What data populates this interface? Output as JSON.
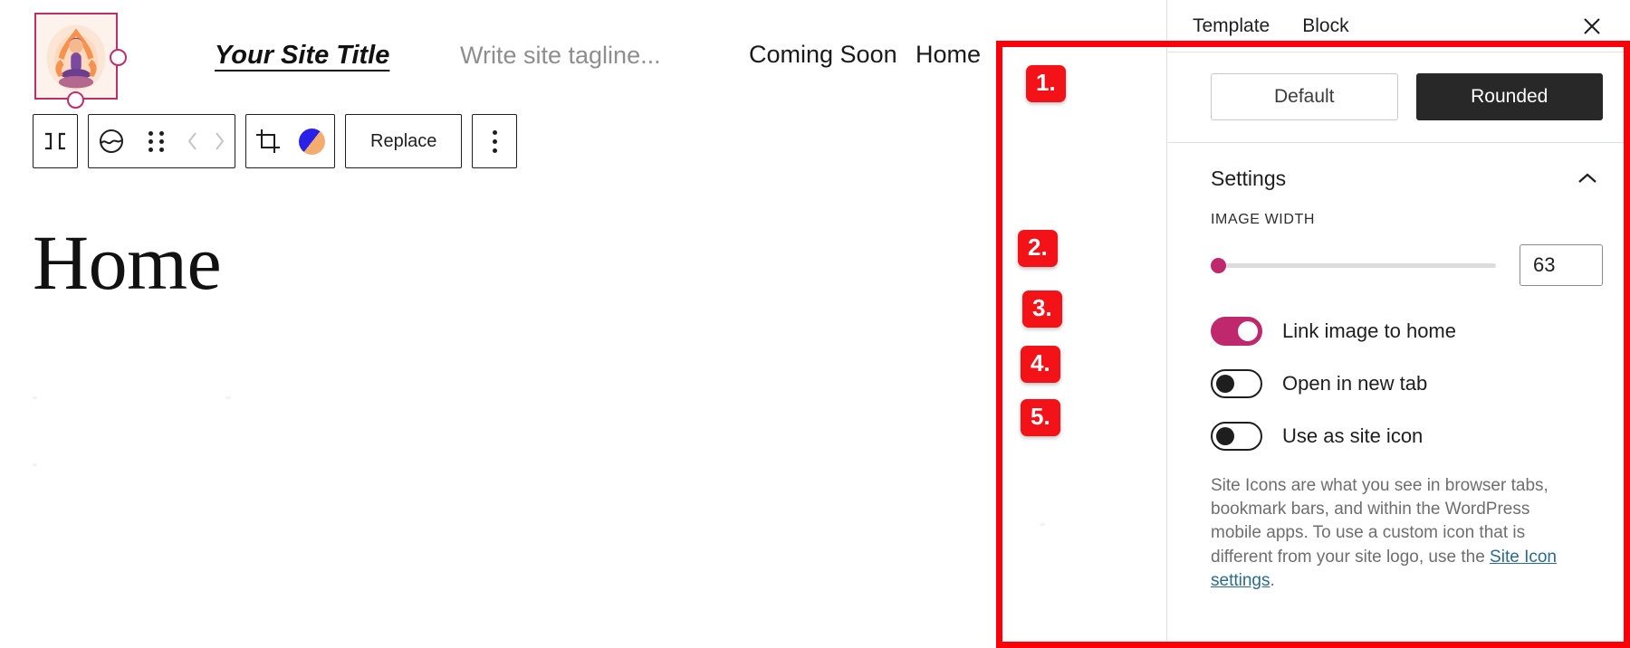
{
  "editor": {
    "site_header": {
      "logo_alt": "site-logo-yoga-illustration",
      "title": "Your Site Title",
      "tagline": "Write site tagline...",
      "nav_items": [
        "Coming Soon",
        "Home"
      ]
    },
    "toolbar": {
      "block_type_icon": "site-logo-icon",
      "transform_icon": "image-block-icon",
      "drag_icon": "drag-handle-icon",
      "move_up_icon": "chevron-left-icon",
      "move_down_icon": "chevron-right-icon",
      "crop_icon": "crop-icon",
      "duotone_icon": "duotone-filter-icon",
      "replace_label": "Replace",
      "more_options_icon": "more-options-icon"
    },
    "page_heading": "Home"
  },
  "sidebar": {
    "tabs": [
      {
        "label": "Template",
        "active": false
      },
      {
        "label": "Block",
        "active": true
      }
    ],
    "close_icon": "close-icon",
    "variations": [
      {
        "label": "Default",
        "selected": false
      },
      {
        "label": "Rounded",
        "selected": true
      }
    ],
    "settings": {
      "title": "Settings",
      "collapse_icon": "chevron-up-icon",
      "image_width": {
        "label": "IMAGE WIDTH",
        "value": "63",
        "slider_percent": 3
      },
      "toggles": [
        {
          "label": "Link image to home",
          "on": true
        },
        {
          "label": "Open in new tab",
          "on": false
        },
        {
          "label": "Use as site icon",
          "on": false
        }
      ],
      "help_text_before": "Site Icons are what you see in browser tabs, bookmark bars, and within the WordPress mobile apps. To use a custom icon that is different from your site logo, use the ",
      "help_link": "Site Icon settings",
      "help_text_after": "."
    }
  },
  "annotations": {
    "badges": [
      "1.",
      "2.",
      "3.",
      "4.",
      "5."
    ],
    "color": "#f41219"
  },
  "colors": {
    "accent_pink": "#c0286e",
    "selected_dark": "#282828",
    "link_blue": "#2b6a8a",
    "annotation_red": "#fb0008"
  }
}
